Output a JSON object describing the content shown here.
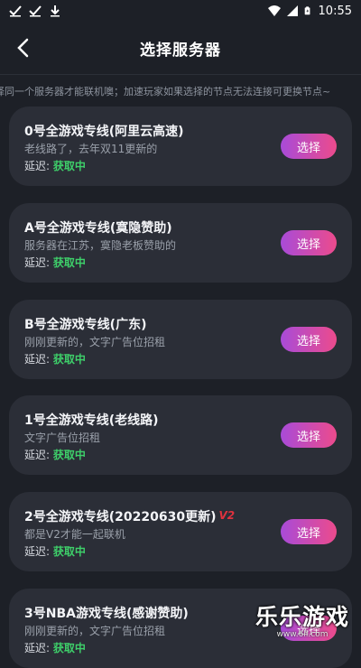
{
  "status_bar": {
    "time": "10:55",
    "left_icons": [
      "check-icon",
      "check-icon",
      "download-icon"
    ],
    "right_icons": [
      "wifi-icon",
      "signal-icon",
      "battery-icon"
    ]
  },
  "header": {
    "title": "选择服务器"
  },
  "notice": "择同一个服务器才能联机噢；加速玩家如果选择的节点无法连接可更换节点~",
  "servers": [
    {
      "name": "0号全游戏专线(阿里云高速)",
      "desc": "老线路了，去年双11更新的",
      "latency_label": "延迟:",
      "latency_value": "获取中",
      "button": "选择"
    },
    {
      "name": "A号全游戏专线(寞隐赞助)",
      "desc": "服务器在江苏，寞隐老板赞助的",
      "latency_label": "延迟:",
      "latency_value": "获取中",
      "button": "选择"
    },
    {
      "name": "B号全游戏专线(广东)",
      "desc": "刚刚更新的，文字广告位招租",
      "latency_label": "延迟:",
      "latency_value": "获取中",
      "button": "选择"
    },
    {
      "name": "1号全游戏专线(老线路)",
      "desc": "文字广告位招租",
      "latency_label": "延迟:",
      "latency_value": "获取中",
      "button": "选择"
    },
    {
      "name": "2号全游戏专线(20220630更新)",
      "badge": "V2",
      "desc": "都是V2才能一起联机",
      "latency_label": "延迟:",
      "latency_value": "获取中",
      "button": "选择"
    },
    {
      "name": "3号NBA游戏专线(感谢赞助)",
      "desc": "刚刚更新的，文字广告位招租",
      "latency_label": "延迟:",
      "latency_value": "获取中",
      "button": "选择"
    }
  ],
  "watermark": {
    "title": "乐乐游戏",
    "url": "www.6ll.com"
  },
  "colors": {
    "background": "#1d2027",
    "card": "#2b2e37",
    "latency_green": "#3ed06a",
    "button_start": "#a84bd8",
    "button_end": "#ec4b8c"
  }
}
